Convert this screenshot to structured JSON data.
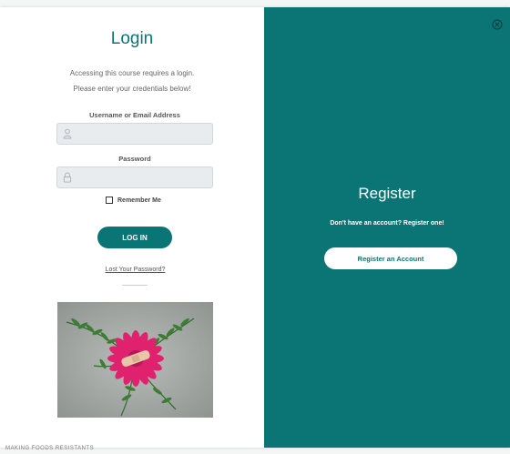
{
  "login": {
    "title": "Login",
    "description_line1": "Accessing this course requires a login.",
    "description_line2": "Please enter your credentials below!",
    "username_label": "Username or Email Address",
    "username_value": "",
    "password_label": "Password",
    "password_value": "",
    "remember_label": "Remember Me",
    "remember_checked": false,
    "button_label": "LOG IN",
    "lost_password_link": "Lost Your Password?",
    "image_icon": "flower-with-bandage-image"
  },
  "register": {
    "title": "Register",
    "description": "Don't have an account? Register one!",
    "button_label": "Register an Account",
    "close_icon": "close-circle-icon"
  },
  "footer": {
    "text": "MAKING FOODS RESISTANTS"
  },
  "colors": {
    "accent": "#0b7475",
    "input_background": "#e9ecef",
    "panel_white": "#ffffff"
  }
}
